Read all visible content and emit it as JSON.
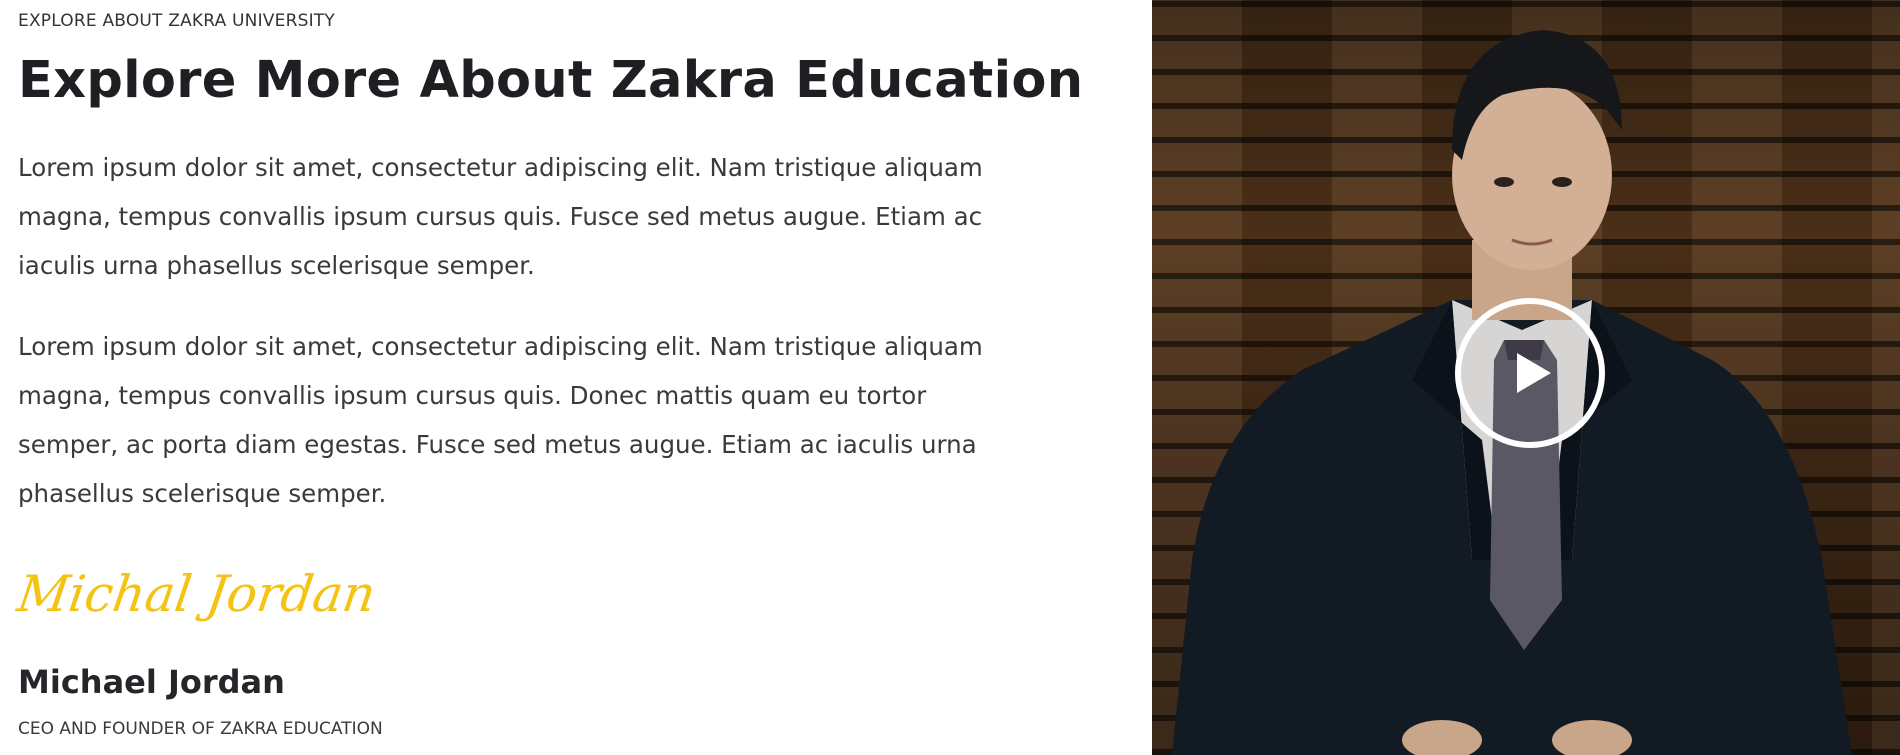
{
  "section": {
    "eyebrow": "EXPLORE ABOUT ZAKRA UNIVERSITY",
    "title": "Explore More About Zakra Education",
    "paragraphs": [
      "Lorem ipsum dolor sit amet, consectetur adipiscing elit. Nam tristique aliquam magna, tempus convallis ipsum cursus quis. Fusce sed metus augue. Etiam ac iaculis urna phasellus scelerisque semper.",
      "Lorem ipsum dolor sit amet, consectetur adipiscing elit. Nam tristique aliquam magna, tempus convallis ipsum cursus quis. Donec mattis quam eu tortor semper, ac porta diam egestas. Fusce sed metus augue. Etiam ac iaculis urna phasellus scelerisque semper."
    ],
    "signature": "Michal Jordan",
    "person_name": "Michael Jordan",
    "person_role": "CEO AND FOUNDER OF ZAKRA EDUCATION"
  },
  "video": {
    "play_icon": "play-icon",
    "accent_color": "#f5c313"
  }
}
